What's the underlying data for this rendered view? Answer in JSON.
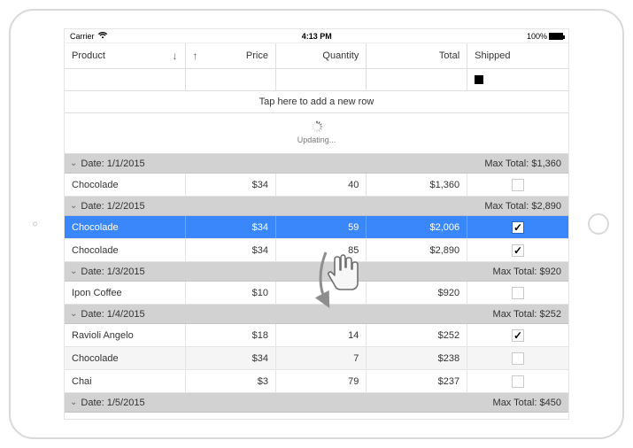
{
  "statusbar": {
    "carrier": "Carrier",
    "time": "4:13 PM",
    "battery": "100%"
  },
  "columns": {
    "product": "Product",
    "price": "Price",
    "quantity": "Quantity",
    "total": "Total",
    "shipped": "Shipped"
  },
  "sort": {
    "product_dir": "↓",
    "price_dir": "↑"
  },
  "addRowHint": "Tap here to add a new row",
  "updatingLabel": "Updating...",
  "groups": [
    {
      "label": "Date: 1/1/2015",
      "summary": "Max Total: $1,360",
      "rows": [
        {
          "product": "Chocolade",
          "price": "$34",
          "qty": "40",
          "total": "$1,360",
          "shipped": false,
          "selected": false,
          "alt": false
        }
      ]
    },
    {
      "label": "Date: 1/2/2015",
      "summary": "Max Total: $2,890",
      "rows": [
        {
          "product": "Chocolade",
          "price": "$34",
          "qty": "59",
          "total": "$2,006",
          "shipped": true,
          "selected": true,
          "alt": false
        },
        {
          "product": "Chocolade",
          "price": "$34",
          "qty": "85",
          "total": "$2,890",
          "shipped": true,
          "selected": false,
          "alt": false
        }
      ]
    },
    {
      "label": "Date: 1/3/2015",
      "summary": "Max Total: $920",
      "rows": [
        {
          "product": "Ipon Coffee",
          "price": "$10",
          "qty": "",
          "total": "$920",
          "shipped": false,
          "selected": false,
          "alt": false
        }
      ]
    },
    {
      "label": "Date: 1/4/2015",
      "summary": "Max Total: $252",
      "rows": [
        {
          "product": "Ravioli Angelo",
          "price": "$18",
          "qty": "14",
          "total": "$252",
          "shipped": true,
          "selected": false,
          "alt": false
        },
        {
          "product": "Chocolade",
          "price": "$34",
          "qty": "7",
          "total": "$238",
          "shipped": false,
          "selected": false,
          "alt": true
        },
        {
          "product": "Chai",
          "price": "$3",
          "qty": "79",
          "total": "$237",
          "shipped": false,
          "selected": false,
          "alt": false
        }
      ]
    },
    {
      "label": "Date: 1/5/2015",
      "summary": "Max Total: $450",
      "rows": []
    }
  ]
}
